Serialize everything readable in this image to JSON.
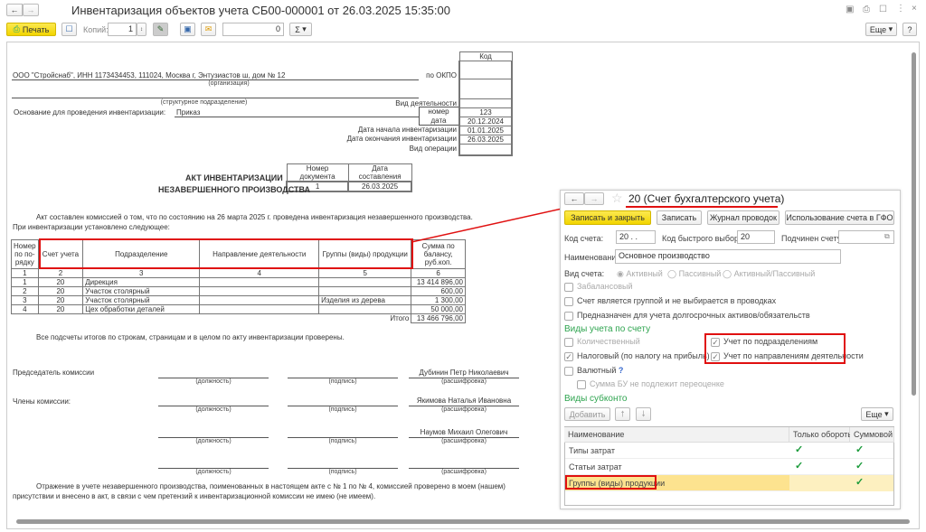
{
  "window": {
    "title": "Инвентаризация объектов учета СБ00-000001 от 26.03.2025 15:35:00",
    "more_label": "Еще",
    "help_label": "?"
  },
  "toolbar": {
    "print_label": "Печать",
    "copies_label": "Копий:",
    "copies_value": "1",
    "sum_value": "0",
    "sigma_label": "Σ"
  },
  "doc": {
    "org": "ООО \"Стройснаб\", ИНН 1173434453, 111024, Москва г, Энтузиастов ш, дом № 12",
    "org_caption": "(организация)",
    "dept_caption": "(структурное подразделение)",
    "basis_label": "Основание для проведения инвентаризации:",
    "basis_value": "Приказ",
    "code_header": "Код",
    "okpo_label": "по ОКПО",
    "activity_label": "Вид деятельности",
    "number_label": "номер",
    "number_value": "123",
    "date_label": "дата",
    "date_value": "20.12.2024",
    "start_label": "Дата начала инвентаризации",
    "start_value": "01.01.2025",
    "end_label": "Дата окончания инвентаризации",
    "end_value": "26.03.2025",
    "operation_label": "Вид операции",
    "docnum_header": "Номер документа",
    "docdate_header": "Дата составления",
    "docnum_value": "1",
    "docdate_value": "26.03.2025",
    "title1": "АКТ ИНВЕНТАРИЗАЦИИ",
    "title2": "НЕЗАВЕРШЕННОГО ПРОИЗВОДСТВА",
    "para1": "Акт составлен комиссией о том, что по состоянию на 26 марта 2025 г. проведена инвентаризация незавершенного производства.",
    "para2": "При инвентаризации установлено следующее:",
    "table": {
      "headers": [
        "Номер по по-рядку",
        "Счет учета",
        "Подразделение",
        "Направление деятельности",
        "Группы (виды) продукции",
        "Сумма по балансу, руб.коп."
      ],
      "numbers": [
        "1",
        "2",
        "3",
        "4",
        "5",
        "6"
      ],
      "rows": [
        [
          "1",
          "20",
          "Дирекция",
          "",
          "",
          "13 414 896,00"
        ],
        [
          "2",
          "20",
          "Участок столярный",
          "",
          "",
          "600,00"
        ],
        [
          "3",
          "20",
          "Участок столярный",
          "",
          "Изделия из дерева",
          "1 300,00"
        ],
        [
          "4",
          "20",
          "Цех обработки деталей",
          "",
          "",
          "50 000,00"
        ]
      ],
      "total_label": "Итого",
      "total_value": "13 466 796,00"
    },
    "checked": "Все подсчеты итогов по строкам, страницам и в целом по акту инвентаризации проверены.",
    "chairman_label": "Председатель комиссии",
    "members_label": "Члены комиссии:",
    "pos_caption": "(должность)",
    "sign_caption": "(подпись)",
    "decode_caption": "(расшифровка)",
    "names": [
      "Дубинин Петр Николаевич",
      "Якимова Наталья Ивановна",
      "Наумов Михаил Олегович",
      ""
    ],
    "final1": "Отражение в учете незавершенного производства, поименованных в настоящем акте с № 1 по № 4, комиссией проверено в моем (нашем)",
    "final2": "присутствии и внесено в акт, в связи с чем претензий к инвентаризационной комиссии не имею (не имеем)."
  },
  "dialog": {
    "title": "20 (Счет бухгалтерского учета)",
    "buttons": [
      "Записать и закрыть",
      "Записать",
      "Журнал проводок",
      "Использование счета в ГФО"
    ],
    "code_label": "Код счета:",
    "code_value": "20 .  .",
    "quick_label": "Код быстрого выбора:",
    "quick_value": "20",
    "parent_label": "Подчинен счету:",
    "parent_value": "",
    "name_label": "Наименование:",
    "name_value": "Основное производство",
    "type_label": "Вид счета:",
    "type_options": [
      "Активный",
      "Пассивный",
      "Активный/Пассивный"
    ],
    "offbalance": "Забалансовый",
    "group": "Счет является группой и не выбирается в проводках",
    "longterm": "Предназначен для учета долгосрочных активов/обязательств",
    "kinds_header": "Виды учета по счету",
    "quantity": "Количественный",
    "tax": "Налоговый (по налогу на прибыль)",
    "currency": "Валютный",
    "help": "?",
    "nonreval": "Сумма БУ не подлежит переоценке",
    "by_dept": "Учет по подразделениям",
    "by_activity": "Учет по направлениям деятельности",
    "subconto_header": "Виды субконто",
    "add_label": "Добавить",
    "more_label": "Еще",
    "sub_headers": [
      "Наименование",
      "Только обороты",
      "Суммовой"
    ],
    "sub_rows": [
      {
        "name": "Типы затрат",
        "turnover": true,
        "sum": true
      },
      {
        "name": "Статьи затрат",
        "turnover": true,
        "sum": true
      },
      {
        "name": "Группы (виды) продукции",
        "turnover": false,
        "sum": true
      }
    ]
  },
  "colors": {
    "accent_yellow": "#f2d500",
    "highlight_red": "#e01010",
    "section_green": "#2ea44f",
    "selected_row": "#fde38f"
  }
}
